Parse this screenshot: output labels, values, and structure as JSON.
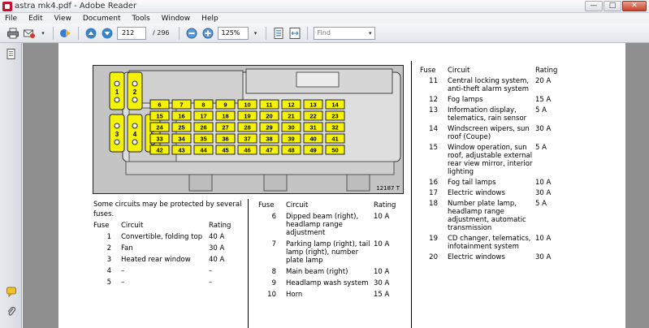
{
  "window": {
    "title": "astra mk4.pdf - Adobe Reader",
    "controls": [
      "minimize-icon",
      "maximize-icon",
      "close-icon"
    ]
  },
  "menu": [
    "File",
    "Edit",
    "View",
    "Document",
    "Tools",
    "Window",
    "Help"
  ],
  "toolbar": {
    "page_current": "212",
    "page_total": "/ 296",
    "zoom": "125%",
    "find_placeholder": "Find",
    "icons": [
      "print-icon",
      "email-icon",
      "collaborate-icon",
      "prev-page-icon",
      "next-page-icon",
      "zoom-out-icon",
      "zoom-in-icon",
      "fit-page-icon",
      "fit-width-icon"
    ]
  },
  "figure": {
    "ref": "12187 T",
    "large_fuses": [
      "1",
      "2",
      "3",
      "4",
      "5"
    ],
    "small_fuse_rows": [
      [
        "6",
        "7",
        "8",
        "9",
        "10",
        "11",
        "12",
        "13",
        "14"
      ],
      [
        "15",
        "16",
        "17",
        "18",
        "19",
        "20",
        "21",
        "22",
        "23"
      ],
      [
        "24",
        "25",
        "26",
        "27",
        "28",
        "29",
        "30",
        "31",
        "32"
      ],
      [
        "33",
        "34",
        "35",
        "36",
        "37",
        "38",
        "39",
        "40",
        "41"
      ],
      [
        "42",
        "43",
        "44",
        "45",
        "46",
        "47",
        "48",
        "49",
        "50"
      ]
    ]
  },
  "intro": "Some circuits may be protected by several fuses.",
  "headers": {
    "fuse": "Fuse",
    "circuit": "Circuit",
    "rating": "Rating"
  },
  "table1": [
    {
      "fuse": "1",
      "circuit": "Convertible, folding top",
      "rating": "40 A"
    },
    {
      "fuse": "2",
      "circuit": "Fan",
      "rating": "30 A"
    },
    {
      "fuse": "3",
      "circuit": "Heated rear window",
      "rating": "40 A"
    },
    {
      "fuse": "4",
      "circuit": "–",
      "rating": "–"
    },
    {
      "fuse": "5",
      "circuit": "–",
      "rating": "–"
    }
  ],
  "table2": [
    {
      "fuse": "6",
      "circuit": "Dipped beam (right), headlamp range adjustment",
      "rating": "10 A"
    },
    {
      "fuse": "7",
      "circuit": "Parking lamp (right), tail lamp (right), number plate lamp",
      "rating": "10 A"
    },
    {
      "fuse": "8",
      "circuit": "Main beam (right)",
      "rating": "10 A"
    },
    {
      "fuse": "9",
      "circuit": "Headlamp wash system",
      "rating": "30 A"
    },
    {
      "fuse": "10",
      "circuit": "Horn",
      "rating": "15 A"
    }
  ],
  "table3": [
    {
      "fuse": "11",
      "circuit": "Central locking system, anti-theft alarm system",
      "rating": "20 A"
    },
    {
      "fuse": "12",
      "circuit": "Fog lamps",
      "rating": "15 A"
    },
    {
      "fuse": "13",
      "circuit": "Information display, telematics, rain sensor",
      "rating": "5 A"
    },
    {
      "fuse": "14",
      "circuit": "Windscreen wipers, sun roof (Coupe)",
      "rating": "30 A"
    },
    {
      "fuse": "15",
      "circuit": "Window operation, sun roof, adjustable external rear view mirror, interior lighting",
      "rating": "5 A"
    },
    {
      "fuse": "16",
      "circuit": "Fog tail lamps",
      "rating": "10 A"
    },
    {
      "fuse": "17",
      "circuit": "Electric windows",
      "rating": "30 A"
    },
    {
      "fuse": "18",
      "circuit": "Number plate lamp, headlamp range adjustment, automatic transmission",
      "rating": "5 A"
    },
    {
      "fuse": "19",
      "circuit": "CD changer, telematics, infotainment system",
      "rating": "10 A"
    },
    {
      "fuse": "20",
      "circuit": "Electric windows",
      "rating": "30 A"
    }
  ],
  "colors": {
    "fuse_yellow": "#f4f20a",
    "page_bg": "#ffffff",
    "doc_bg": "#8f8f8f"
  }
}
